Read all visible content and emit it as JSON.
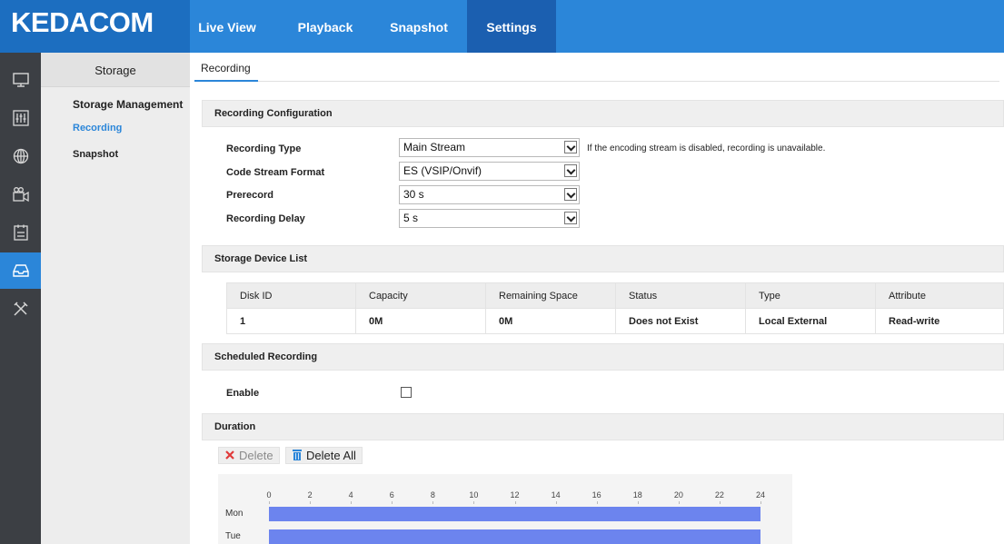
{
  "brand": {
    "logo": "KEDACOM"
  },
  "nav": {
    "tabs": [
      {
        "label": "Live View"
      },
      {
        "label": "Playback"
      },
      {
        "label": "Snapshot"
      },
      {
        "label": "Settings",
        "active": true
      }
    ]
  },
  "rail": {
    "icons": [
      "monitor-icon",
      "equalizer-icon",
      "network-icon",
      "camera-icon",
      "event-icon",
      "storage-icon",
      "tools-icon"
    ],
    "active": "storage-icon"
  },
  "sidebar": {
    "title": "Storage",
    "items": [
      {
        "label": "Storage Management"
      },
      {
        "label": "Recording",
        "active": true
      },
      {
        "label": "Snapshot"
      }
    ]
  },
  "page": {
    "tab": "Recording"
  },
  "recording_config": {
    "title": "Recording Configuration",
    "fields": [
      {
        "label": "Recording Type",
        "value": "Main Stream"
      },
      {
        "label": "Code Stream Format",
        "value": "ES (VSIP/Onvif)"
      },
      {
        "label": "Prerecord",
        "value": "30 s"
      },
      {
        "label": "Recording Delay",
        "value": "5 s"
      }
    ],
    "hint": "If the encoding stream is disabled, recording is unavailable."
  },
  "storage_list": {
    "title": "Storage Device List",
    "headers": [
      "Disk ID",
      "Capacity",
      "Remaining Space",
      "Status",
      "Type",
      "Attribute"
    ],
    "rows": [
      [
        "1",
        "0M",
        "0M",
        "Does not Exist",
        "Local External",
        "Read-write"
      ]
    ]
  },
  "scheduled": {
    "title": "Scheduled Recording",
    "enable_label": "Enable",
    "enabled": false
  },
  "duration": {
    "title": "Duration",
    "delete_label": "Delete",
    "delete_all_label": "Delete All",
    "hours": [
      "0",
      "2",
      "4",
      "6",
      "8",
      "10",
      "12",
      "14",
      "16",
      "18",
      "20",
      "22",
      "24"
    ],
    "days": [
      {
        "label": "Mon",
        "start": 0,
        "end": 24
      },
      {
        "label": "Tue",
        "start": 0,
        "end": 24
      }
    ]
  },
  "colors": {
    "accent": "#2b86d9",
    "schedule_bar": "#6c84ee",
    "delete_x": "#e03a3a"
  }
}
